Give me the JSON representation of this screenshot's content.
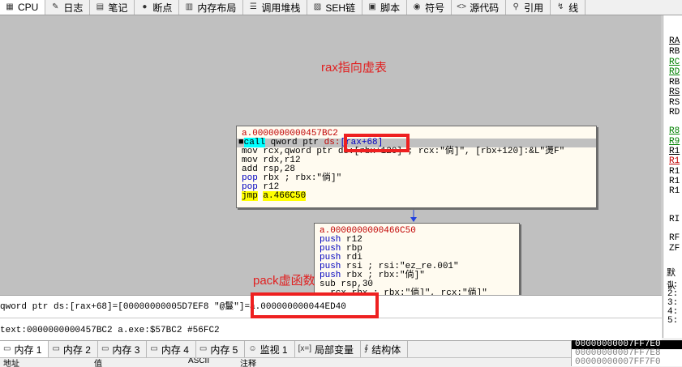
{
  "top_tabs": [
    {
      "label": "CPU",
      "icon": "cpu-icon",
      "glyph": "▦"
    },
    {
      "label": "日志",
      "icon": "log-icon",
      "glyph": "✎"
    },
    {
      "label": "笔记",
      "icon": "notes-icon",
      "glyph": "▤"
    },
    {
      "label": "断点",
      "icon": "breakpoint-icon",
      "glyph": "●"
    },
    {
      "label": "内存布局",
      "icon": "memory-map-icon",
      "glyph": "▥"
    },
    {
      "label": "调用堆栈",
      "icon": "call-stack-icon",
      "glyph": "☰"
    },
    {
      "label": "SEH链",
      "icon": "seh-chain-icon",
      "glyph": "▨"
    },
    {
      "label": "脚本",
      "icon": "script-icon",
      "glyph": "▣"
    },
    {
      "label": "符号",
      "icon": "symbols-icon",
      "glyph": "◉"
    },
    {
      "label": "源代码",
      "icon": "source-icon",
      "glyph": "<>"
    },
    {
      "label": "引用",
      "icon": "references-icon",
      "glyph": "⚲"
    },
    {
      "label": "线",
      "icon": "threads-icon",
      "glyph": "↯"
    }
  ],
  "annotations": {
    "rax_note": "rax指向虚表",
    "pack_note": "pack虚函数"
  },
  "block1": {
    "title": "a.0000000000457BC2",
    "lines": [
      {
        "mnem": "call",
        "ops_pre": " qword ptr ",
        "ops_seg": "ds:",
        "ops_mem": "[rax+68]",
        "marker": "■"
      },
      {
        "text": "mov rcx,qword ptr ds:[rbx+120] ; rcx:\"倘]\", [rbx+120]:&L\"燙F\""
      },
      {
        "text": "mov rdx,r12"
      },
      {
        "text": "add rsp,28"
      },
      {
        "mnem": "pop",
        "text": " rbx ; rbx:\"倘]\""
      },
      {
        "mnem": "pop",
        "text": " r12"
      },
      {
        "mnem": "jmp",
        "target": "a.466C50"
      }
    ]
  },
  "block2": {
    "title": "a.0000000000466C50",
    "lines": [
      {
        "mnem": "push",
        "text": " r12"
      },
      {
        "mnem": "push",
        "text": " rbp"
      },
      {
        "mnem": "push",
        "text": " rdi"
      },
      {
        "mnem": "push",
        "text": " rsi ; rsi:\"ez_re.001\""
      },
      {
        "mnem": "push",
        "text": " rbx ; rbx:\"倘]\""
      },
      {
        "mnem": "sub",
        "text": " rsp,30"
      },
      {
        "text": "  rcx,rbx ; rbx:\"倘]\", rcx:\"倘]\""
      }
    ]
  },
  "info": {
    "line1": "qword ptr ds:[rax+68]=[00000000005D7EF8 \"@鬘\"]=a.000000000044ED40",
    "line2": "text:0000000000457BC2 a.exe:$57BC2 #56FC2"
  },
  "registers": [
    {
      "name": "RA",
      "style": "black ul"
    },
    {
      "name": "RB",
      "style": "black"
    },
    {
      "name": "RC",
      "style": "green ul"
    },
    {
      "name": "RD",
      "style": "green ul"
    },
    {
      "name": "RB",
      "style": "black"
    },
    {
      "name": "RS",
      "style": "black ul"
    },
    {
      "name": "RS",
      "style": "black"
    },
    {
      "name": "RD",
      "style": "black"
    },
    {
      "name": "R8",
      "style": "green ul"
    },
    {
      "name": "R9",
      "style": "green ul"
    },
    {
      "name": "R1",
      "style": "black ul"
    },
    {
      "name": "R1",
      "style": "red ul"
    },
    {
      "name": "R1",
      "style": "black"
    },
    {
      "name": "R1",
      "style": "black"
    },
    {
      "name": "R1",
      "style": "black"
    },
    {
      "name": "RI",
      "style": "black"
    },
    {
      "name": "RF",
      "style": "black"
    },
    {
      "name": "ZF",
      "style": "black"
    }
  ],
  "right_panel": {
    "header": "默认",
    "rows": [
      "1:",
      "2:",
      "3:",
      "4:",
      "5:"
    ]
  },
  "bottom_tabs": [
    {
      "label": "内存 1",
      "icon": "memory-icon",
      "glyph": "▭"
    },
    {
      "label": "内存 2",
      "icon": "memory-icon",
      "glyph": "▭"
    },
    {
      "label": "内存 3",
      "icon": "memory-icon",
      "glyph": "▭"
    },
    {
      "label": "内存 4",
      "icon": "memory-icon",
      "glyph": "▭"
    },
    {
      "label": "内存 5",
      "icon": "memory-icon",
      "glyph": "▭"
    },
    {
      "label": "监视 1",
      "icon": "watch-icon",
      "glyph": "☺"
    },
    {
      "label": "局部变量",
      "icon": "locals-icon",
      "glyph": "[x=]"
    },
    {
      "label": "结构体",
      "icon": "struct-icon",
      "glyph": "∮"
    }
  ],
  "dump_header": {
    "col_addr": "地址",
    "col_hex": "值",
    "col_ascii": "ASCII",
    "col_comment": "注释"
  },
  "stack_rows": [
    "00000000007FF7E0",
    "00000000007FF7E8",
    "00000000007FF7F0"
  ]
}
